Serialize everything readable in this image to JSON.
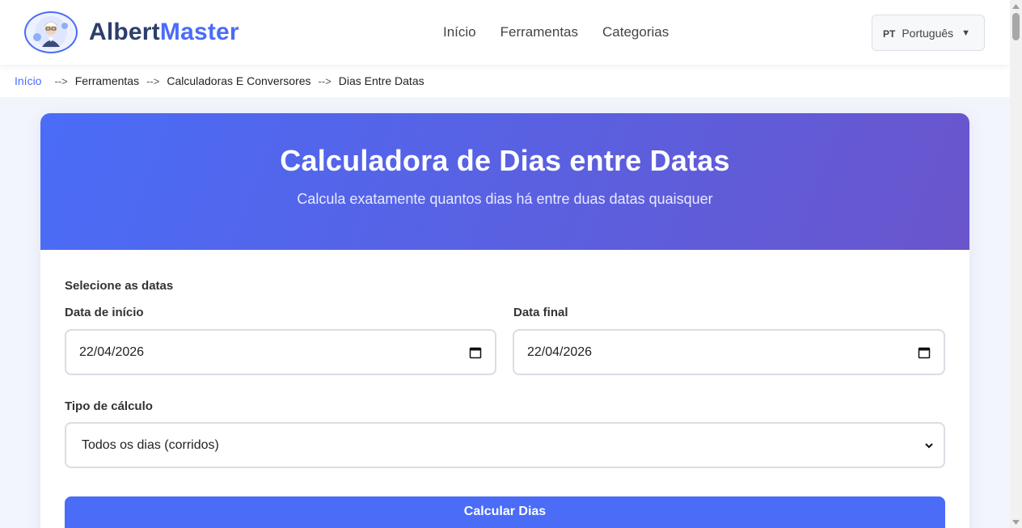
{
  "header": {
    "logo": {
      "part1": "Albert",
      "part2": "Master"
    },
    "nav": [
      {
        "label": "Início"
      },
      {
        "label": "Ferramentas"
      },
      {
        "label": "Categorias"
      }
    ],
    "language": {
      "code": "PT",
      "label": "Português",
      "caret": "▼"
    }
  },
  "breadcrumb": {
    "items": [
      "Início",
      "Ferramentas",
      "Calculadoras E Conversores",
      "Dias Entre Datas"
    ],
    "separator": "-->"
  },
  "hero": {
    "title": "Calculadora de Dias entre Datas",
    "subtitle": "Calcula exatamente quantos dias há entre duas datas quaisquer"
  },
  "form": {
    "section_label": "Selecione as datas",
    "start_date": {
      "label": "Data de início",
      "value": "22/04/2026"
    },
    "end_date": {
      "label": "Data final",
      "value": "22/04/2026"
    },
    "calc_type": {
      "label": "Tipo de cálculo",
      "value": "Todos os dias (corridos)"
    },
    "submit_label": "Calcular Dias"
  },
  "colors": {
    "accent": "#4a6cf7",
    "hero_gradient_end": "#6a55cc",
    "page_background": "#f3f5fd"
  }
}
